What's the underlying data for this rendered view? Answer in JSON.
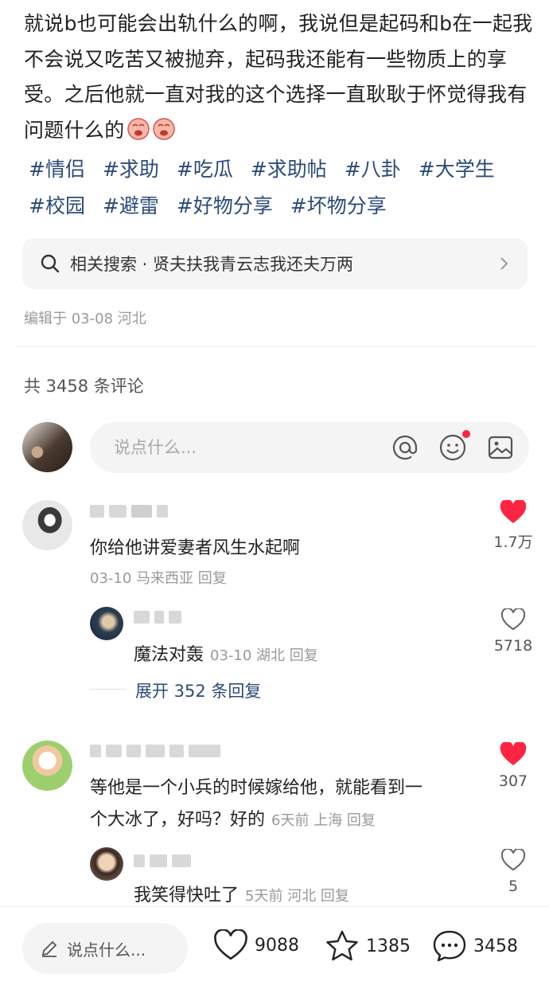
{
  "post": {
    "text": "就说b也可能会出轨什么的啊，我说但是起码和b在一起我不会说又吃苦又被抛弃，起码我还能有一些物质上的享受。之后他就一直对我的这个选择一直耿耿于怀觉得我有问题什么的",
    "tags": [
      "#情侣",
      "#求助",
      "#吃瓜",
      "#求助帖",
      "#八卦",
      "#大学生",
      "#校园",
      "#避雷",
      "#好物分享",
      "#坏物分享"
    ],
    "emoji_icon": "crying-face-emoji"
  },
  "related": {
    "label": "相关搜索 · 贤夫扶我青云志我还夫万两"
  },
  "edited": "编辑于 03-08 河北",
  "comments_total": "共 3458 条评论",
  "comment_input": {
    "placeholder": "说点什么..."
  },
  "comments": [
    {
      "text": "你给他讲爱妻者风生水起啊",
      "meta": "03-10 马来西亚 回复",
      "likes": "1.7万",
      "liked": true,
      "reply": {
        "text": "魔法对轰",
        "meta": "03-10 湖北 回复",
        "likes": "5718"
      },
      "expand": "展开 352 条回复"
    },
    {
      "text": "等他是一个小兵的时候嫁给他，就能看到一个大冰了，好吗？好的",
      "text_line1": "等他是一个小兵的时候嫁给他，就能看到一",
      "text_line2": "个大冰了，好吗？好的",
      "meta": "6天前 上海 回复",
      "likes": "307",
      "liked": true,
      "reply": {
        "text": "我笑得快吐了",
        "meta": "5天前 河北 回复",
        "likes": "5"
      }
    }
  ],
  "bottom_bar": {
    "input_placeholder": "说点什么...",
    "likes": "9088",
    "favorites": "1385",
    "comments": "3458"
  },
  "colors": {
    "accent_red": "#ff2442",
    "tag_blue": "#2b4b7a"
  }
}
